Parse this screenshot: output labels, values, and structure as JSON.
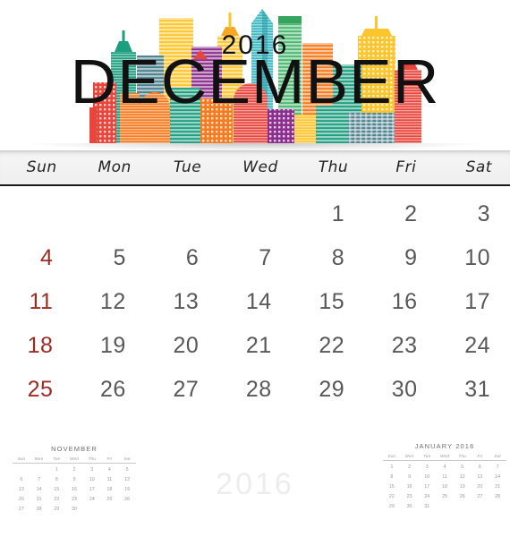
{
  "header": {
    "month": "DECEMBER",
    "year": "2016",
    "artwork": "city-skyline-illustration"
  },
  "weekdays": [
    "Sun",
    "Mon",
    "Tue",
    "Wed",
    "Thu",
    "Fri",
    "Sat"
  ],
  "calendar": {
    "month_name": "DECEMBER",
    "year": "2016",
    "first_weekday_index": 4,
    "days_in_month": 31,
    "weeks": [
      [
        "",
        "",
        "",
        "",
        "1",
        "2",
        "3"
      ],
      [
        "4",
        "5",
        "6",
        "7",
        "8",
        "9",
        "10"
      ],
      [
        "11",
        "12",
        "13",
        "14",
        "15",
        "16",
        "17"
      ],
      [
        "18",
        "19",
        "20",
        "21",
        "22",
        "23",
        "24"
      ],
      [
        "25",
        "26",
        "27",
        "28",
        "29",
        "30",
        "31"
      ]
    ]
  },
  "watermark": "2016",
  "mini_calendars": [
    {
      "title": "NOVEMBER",
      "weekdays": [
        "Sun",
        "Mon",
        "Tue",
        "Wed",
        "Thu",
        "Fri",
        "Sat"
      ],
      "weeks": [
        [
          "",
          "",
          "1",
          "2",
          "3",
          "4",
          "5"
        ],
        [
          "6",
          "7",
          "8",
          "9",
          "10",
          "11",
          "12"
        ],
        [
          "13",
          "14",
          "15",
          "16",
          "17",
          "18",
          "19"
        ],
        [
          "20",
          "21",
          "22",
          "23",
          "24",
          "25",
          "26"
        ],
        [
          "27",
          "28",
          "29",
          "30",
          "",
          "",
          ""
        ]
      ]
    },
    {
      "title": "JANUARY 2016",
      "weekdays": [
        "Sun",
        "Mon",
        "Tue",
        "Wed",
        "Thu",
        "Fri",
        "Sat"
      ],
      "weeks": [
        [
          "1",
          "2",
          "3",
          "4",
          "5",
          "6",
          "7"
        ],
        [
          "8",
          "9",
          "10",
          "11",
          "12",
          "13",
          "14"
        ],
        [
          "15",
          "16",
          "17",
          "18",
          "19",
          "20",
          "21"
        ],
        [
          "22",
          "23",
          "24",
          "25",
          "26",
          "27",
          "28"
        ],
        [
          "29",
          "30",
          "31",
          "",
          "",
          "",
          ""
        ]
      ]
    }
  ],
  "colors": {
    "sunday_text": "#9e2b23",
    "weekday_text": "#58585a",
    "title_text": "#111111",
    "watermark": "#ededed",
    "skyline_red": "#e8453c",
    "skyline_orange": "#f47b20",
    "skyline_yellow": "#fbc52d",
    "skyline_teal": "#1d9e7e",
    "skyline_green": "#4cb872",
    "skyline_cyan": "#3bb8c3",
    "skyline_purple": "#8b2f8e",
    "skyline_bluegray": "#4a7f8c",
    "background": "#ffffff"
  }
}
